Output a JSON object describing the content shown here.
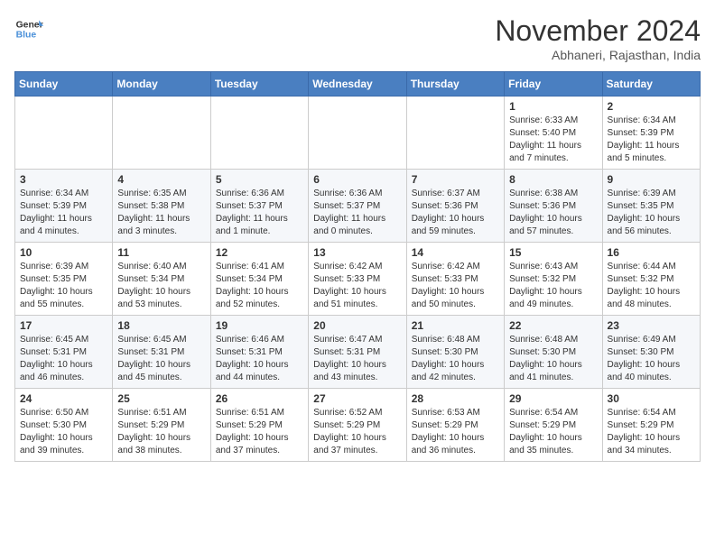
{
  "header": {
    "logo_line1": "General",
    "logo_line2": "Blue",
    "month_year": "November 2024",
    "location": "Abhaneri, Rajasthan, India"
  },
  "weekdays": [
    "Sunday",
    "Monday",
    "Tuesday",
    "Wednesday",
    "Thursday",
    "Friday",
    "Saturday"
  ],
  "weeks": [
    [
      {
        "day": "",
        "info": ""
      },
      {
        "day": "",
        "info": ""
      },
      {
        "day": "",
        "info": ""
      },
      {
        "day": "",
        "info": ""
      },
      {
        "day": "",
        "info": ""
      },
      {
        "day": "1",
        "info": "Sunrise: 6:33 AM\nSunset: 5:40 PM\nDaylight: 11 hours and 7 minutes."
      },
      {
        "day": "2",
        "info": "Sunrise: 6:34 AM\nSunset: 5:39 PM\nDaylight: 11 hours and 5 minutes."
      }
    ],
    [
      {
        "day": "3",
        "info": "Sunrise: 6:34 AM\nSunset: 5:39 PM\nDaylight: 11 hours and 4 minutes."
      },
      {
        "day": "4",
        "info": "Sunrise: 6:35 AM\nSunset: 5:38 PM\nDaylight: 11 hours and 3 minutes."
      },
      {
        "day": "5",
        "info": "Sunrise: 6:36 AM\nSunset: 5:37 PM\nDaylight: 11 hours and 1 minute."
      },
      {
        "day": "6",
        "info": "Sunrise: 6:36 AM\nSunset: 5:37 PM\nDaylight: 11 hours and 0 minutes."
      },
      {
        "day": "7",
        "info": "Sunrise: 6:37 AM\nSunset: 5:36 PM\nDaylight: 10 hours and 59 minutes."
      },
      {
        "day": "8",
        "info": "Sunrise: 6:38 AM\nSunset: 5:36 PM\nDaylight: 10 hours and 57 minutes."
      },
      {
        "day": "9",
        "info": "Sunrise: 6:39 AM\nSunset: 5:35 PM\nDaylight: 10 hours and 56 minutes."
      }
    ],
    [
      {
        "day": "10",
        "info": "Sunrise: 6:39 AM\nSunset: 5:35 PM\nDaylight: 10 hours and 55 minutes."
      },
      {
        "day": "11",
        "info": "Sunrise: 6:40 AM\nSunset: 5:34 PM\nDaylight: 10 hours and 53 minutes."
      },
      {
        "day": "12",
        "info": "Sunrise: 6:41 AM\nSunset: 5:34 PM\nDaylight: 10 hours and 52 minutes."
      },
      {
        "day": "13",
        "info": "Sunrise: 6:42 AM\nSunset: 5:33 PM\nDaylight: 10 hours and 51 minutes."
      },
      {
        "day": "14",
        "info": "Sunrise: 6:42 AM\nSunset: 5:33 PM\nDaylight: 10 hours and 50 minutes."
      },
      {
        "day": "15",
        "info": "Sunrise: 6:43 AM\nSunset: 5:32 PM\nDaylight: 10 hours and 49 minutes."
      },
      {
        "day": "16",
        "info": "Sunrise: 6:44 AM\nSunset: 5:32 PM\nDaylight: 10 hours and 48 minutes."
      }
    ],
    [
      {
        "day": "17",
        "info": "Sunrise: 6:45 AM\nSunset: 5:31 PM\nDaylight: 10 hours and 46 minutes."
      },
      {
        "day": "18",
        "info": "Sunrise: 6:45 AM\nSunset: 5:31 PM\nDaylight: 10 hours and 45 minutes."
      },
      {
        "day": "19",
        "info": "Sunrise: 6:46 AM\nSunset: 5:31 PM\nDaylight: 10 hours and 44 minutes."
      },
      {
        "day": "20",
        "info": "Sunrise: 6:47 AM\nSunset: 5:31 PM\nDaylight: 10 hours and 43 minutes."
      },
      {
        "day": "21",
        "info": "Sunrise: 6:48 AM\nSunset: 5:30 PM\nDaylight: 10 hours and 42 minutes."
      },
      {
        "day": "22",
        "info": "Sunrise: 6:48 AM\nSunset: 5:30 PM\nDaylight: 10 hours and 41 minutes."
      },
      {
        "day": "23",
        "info": "Sunrise: 6:49 AM\nSunset: 5:30 PM\nDaylight: 10 hours and 40 minutes."
      }
    ],
    [
      {
        "day": "24",
        "info": "Sunrise: 6:50 AM\nSunset: 5:30 PM\nDaylight: 10 hours and 39 minutes."
      },
      {
        "day": "25",
        "info": "Sunrise: 6:51 AM\nSunset: 5:29 PM\nDaylight: 10 hours and 38 minutes."
      },
      {
        "day": "26",
        "info": "Sunrise: 6:51 AM\nSunset: 5:29 PM\nDaylight: 10 hours and 37 minutes."
      },
      {
        "day": "27",
        "info": "Sunrise: 6:52 AM\nSunset: 5:29 PM\nDaylight: 10 hours and 37 minutes."
      },
      {
        "day": "28",
        "info": "Sunrise: 6:53 AM\nSunset: 5:29 PM\nDaylight: 10 hours and 36 minutes."
      },
      {
        "day": "29",
        "info": "Sunrise: 6:54 AM\nSunset: 5:29 PM\nDaylight: 10 hours and 35 minutes."
      },
      {
        "day": "30",
        "info": "Sunrise: 6:54 AM\nSunset: 5:29 PM\nDaylight: 10 hours and 34 minutes."
      }
    ]
  ]
}
